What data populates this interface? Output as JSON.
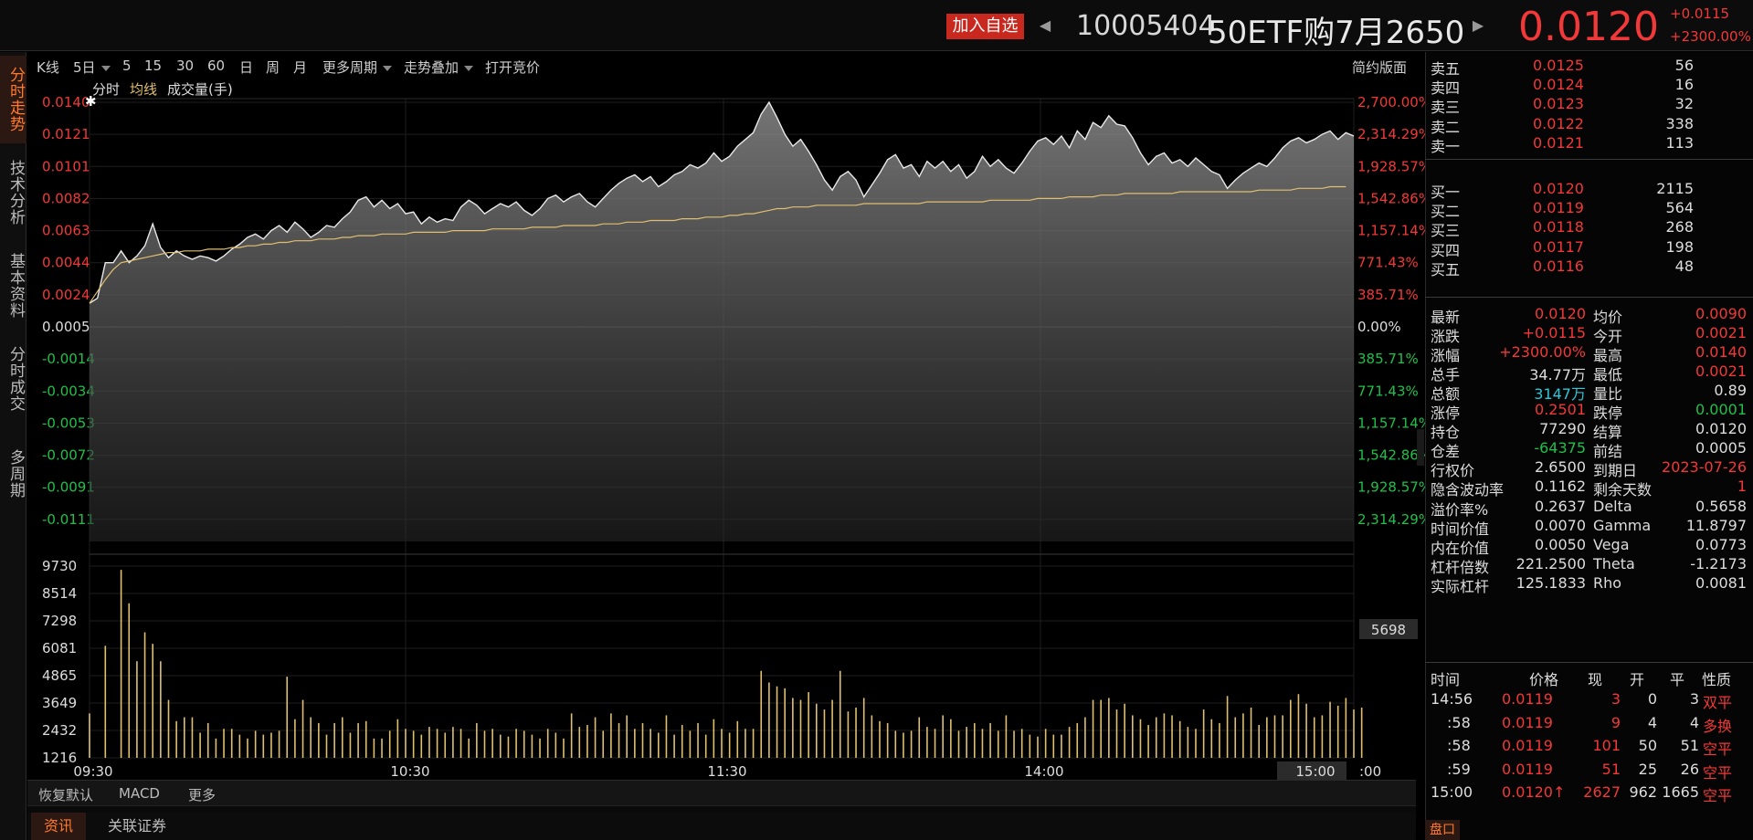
{
  "header": {
    "watch_label": "加入自选",
    "prev_icon": "◀",
    "next_icon": "▶",
    "code": "10005404",
    "name": "50ETF购7月2650",
    "price": "0.0120",
    "change": "+0.0115",
    "change_pct": "+2300.00%"
  },
  "left_tabs": [
    {
      "label": "分时走势",
      "active": true
    },
    {
      "label": "技术分析",
      "active": false
    },
    {
      "label": "基本资料",
      "active": false
    },
    {
      "label": "分时成交",
      "active": false
    },
    {
      "label": "多周期",
      "active": false
    }
  ],
  "toolbar": {
    "items": [
      "K线",
      "5日",
      "5",
      "15",
      "30",
      "60",
      "日",
      "周",
      "月"
    ],
    "more_periods": "更多周期",
    "overlay": "走势叠加",
    "auction": "打开竞价",
    "simple_layout": "简约版面"
  },
  "legend": {
    "timeshare": "分时",
    "avg": "均线",
    "volume": "成交量(手)"
  },
  "chart_data": {
    "type": "line",
    "price_axis_labels": [
      "0.0140",
      "0.0121",
      "0.0101",
      "0.0082",
      "0.0063",
      "0.0044",
      "0.0024",
      "0.0005",
      "-0.0014",
      "-0.0034",
      "-0.0053",
      "-0.0072",
      "-0.0091",
      "-0.0111"
    ],
    "pct_axis_labels": [
      "2,700.00%",
      "2,314.29%",
      "1,928.57%",
      "1,542.86%",
      "1,157.14%",
      "771.43%",
      "385.71%",
      "0.00%",
      "385.71%",
      "771.43%",
      "1,157.14%",
      "1,542.86%",
      "1,928.57%",
      "2,314.29%"
    ],
    "ylim": [
      -0.013,
      0.014
    ],
    "base_price": 0.0005,
    "volume_axis_labels": [
      "9730",
      "8514",
      "7298",
      "6081",
      "4865",
      "3649",
      "2432",
      "1216"
    ],
    "volume_max": 10400,
    "volume_cursor_label": "5698",
    "time_labels": [
      "09:30",
      "10:30",
      "11:30",
      "14:00",
      "15:00"
    ],
    "end_time_fragment": ":00",
    "price_series": [
      0.0021,
      0.0024,
      0.0045,
      0.0045,
      0.0052,
      0.0045,
      0.0049,
      0.0055,
      0.0068,
      0.0054,
      0.0048,
      0.0052,
      0.0049,
      0.0047,
      0.0049,
      0.0048,
      0.0046,
      0.0049,
      0.0053,
      0.0056,
      0.006,
      0.0062,
      0.0059,
      0.0064,
      0.0067,
      0.0063,
      0.0069,
      0.0065,
      0.006,
      0.0063,
      0.0067,
      0.0066,
      0.0071,
      0.0075,
      0.0082,
      0.0084,
      0.0078,
      0.0082,
      0.0077,
      0.008,
      0.0074,
      0.0075,
      0.0068,
      0.0072,
      0.0069,
      0.0071,
      0.007,
      0.0078,
      0.0082,
      0.0079,
      0.0074,
      0.0077,
      0.008,
      0.0078,
      0.0081,
      0.0076,
      0.0073,
      0.0077,
      0.0083,
      0.0085,
      0.0081,
      0.0084,
      0.0086,
      0.0081,
      0.0078,
      0.0083,
      0.0088,
      0.0092,
      0.0095,
      0.0097,
      0.0093,
      0.0096,
      0.009,
      0.0093,
      0.0097,
      0.0099,
      0.0103,
      0.0101,
      0.0104,
      0.011,
      0.0105,
      0.0108,
      0.0114,
      0.0118,
      0.0122,
      0.0133,
      0.014,
      0.0131,
      0.0121,
      0.0114,
      0.0118,
      0.0111,
      0.0103,
      0.0094,
      0.0088,
      0.0096,
      0.0099,
      0.0094,
      0.0084,
      0.0091,
      0.0098,
      0.0106,
      0.0109,
      0.0101,
      0.0103,
      0.0096,
      0.0105,
      0.0101,
      0.0105,
      0.0099,
      0.0103,
      0.0095,
      0.0099,
      0.0108,
      0.0102,
      0.0106,
      0.0101,
      0.0098,
      0.0104,
      0.0111,
      0.0117,
      0.0119,
      0.0115,
      0.012,
      0.0113,
      0.0123,
      0.0118,
      0.0128,
      0.0125,
      0.0132,
      0.0127,
      0.0126,
      0.0119,
      0.011,
      0.0103,
      0.0108,
      0.011,
      0.0104,
      0.0106,
      0.0102,
      0.0107,
      0.0103,
      0.0099,
      0.0097,
      0.0089,
      0.0094,
      0.0098,
      0.0101,
      0.0104,
      0.0102,
      0.0107,
      0.0113,
      0.0117,
      0.0119,
      0.0116,
      0.0118,
      0.0121,
      0.0123,
      0.0118,
      0.0122,
      0.012
    ],
    "avg_series": [
      0.0021,
      0.0028,
      0.0035,
      0.0041,
      0.0045,
      0.0046,
      0.0047,
      0.0048,
      0.0049,
      0.005,
      0.0051,
      0.0051,
      0.0052,
      0.0052,
      0.0052,
      0.0053,
      0.0053,
      0.0053,
      0.0054,
      0.0054,
      0.0055,
      0.0055,
      0.0056,
      0.0056,
      0.0057,
      0.0057,
      0.0058,
      0.0058,
      0.0058,
      0.0059,
      0.0059,
      0.0059,
      0.006,
      0.006,
      0.0061,
      0.0061,
      0.0061,
      0.0062,
      0.0062,
      0.0062,
      0.0062,
      0.0063,
      0.0063,
      0.0063,
      0.0063,
      0.0063,
      0.0064,
      0.0064,
      0.0064,
      0.0064,
      0.0064,
      0.0065,
      0.0065,
      0.0065,
      0.0065,
      0.0065,
      0.0066,
      0.0066,
      0.0066,
      0.0066,
      0.0067,
      0.0067,
      0.0067,
      0.0067,
      0.0067,
      0.0068,
      0.0068,
      0.0068,
      0.0069,
      0.0069,
      0.0069,
      0.007,
      0.007,
      0.007,
      0.007,
      0.0071,
      0.0071,
      0.0071,
      0.0072,
      0.0072,
      0.0072,
      0.0073,
      0.0073,
      0.0074,
      0.0074,
      0.0075,
      0.0076,
      0.0077,
      0.0077,
      0.0078,
      0.0078,
      0.0078,
      0.0079,
      0.0079,
      0.0079,
      0.0079,
      0.0079,
      0.0079,
      0.008,
      0.008,
      0.008,
      0.008,
      0.008,
      0.008,
      0.008,
      0.008,
      0.0081,
      0.0081,
      0.0081,
      0.0081,
      0.0081,
      0.0081,
      0.0081,
      0.0081,
      0.0082,
      0.0082,
      0.0082,
      0.0082,
      0.0082,
      0.0082,
      0.0083,
      0.0083,
      0.0083,
      0.0083,
      0.0084,
      0.0084,
      0.0084,
      0.0084,
      0.0085,
      0.0085,
      0.0085,
      0.0086,
      0.0086,
      0.0086,
      0.0086,
      0.0086,
      0.0086,
      0.0086,
      0.0087,
      0.0087,
      0.0087,
      0.0087,
      0.0087,
      0.0087,
      0.0087,
      0.0087,
      0.0087,
      0.0087,
      0.0088,
      0.0088,
      0.0088,
      0.0088,
      0.0088,
      0.0089,
      0.0089,
      0.0089,
      0.0089,
      0.009,
      0.009,
      0.009
    ],
    "volume_series": [
      2300,
      0,
      5800,
      0,
      9730,
      8000,
      5000,
      6500,
      5900,
      5000,
      3000,
      1900,
      2100,
      2100,
      1300,
      1800,
      1000,
      1500,
      1500,
      1200,
      1000,
      1400,
      1200,
      1300,
      1400,
      4200,
      2000,
      3000,
      2100,
      1800,
      1200,
      1800,
      2100,
      1300,
      1800,
      1900,
      1000,
      1000,
      1400,
      2000,
      1500,
      1400,
      1200,
      1600,
      1500,
      1300,
      1600,
      1500,
      1000,
      1800,
      1400,
      1500,
      1200,
      1100,
      1500,
      1400,
      1200,
      1000,
      1500,
      1300,
      1000,
      2300,
      1600,
      1700,
      2100,
      1400,
      2300,
      1800,
      2200,
      1500,
      1800,
      1500,
      1300,
      2200,
      1200,
      1700,
      1400,
      1800,
      1200,
      2000,
      1500,
      1300,
      1900,
      1500,
      1500,
      4500,
      3900,
      3700,
      3600,
      3100,
      3000,
      3400,
      2800,
      2500,
      3000,
      4500,
      2400,
      2600,
      3100,
      2200,
      1900,
      1800,
      1400,
      1300,
      1400,
      2100,
      1600,
      1500,
      2200,
      2000,
      1400,
      1600,
      1800,
      1500,
      1800,
      1400,
      2200,
      1400,
      1500,
      1200,
      1100,
      1500,
      1200,
      1200,
      1600,
      1800,
      2100,
      3000,
      3000,
      3100,
      2500,
      2800,
      2200,
      2000,
      1700,
      2100,
      2300,
      2200,
      1900,
      1600,
      1500,
      2500,
      2000,
      1800,
      3200,
      2100,
      2300,
      2600,
      1700,
      2100,
      2200,
      2200,
      3000,
      3300,
      2800,
      2100,
      2200,
      2900,
      2700,
      3100,
      2500,
      2600
    ]
  },
  "bottom_bar": {
    "restore": "恢复默认",
    "macd": "MACD",
    "more": "更多"
  },
  "footer": {
    "news": "资讯",
    "related": "关联证券"
  },
  "orderbook": {
    "sell": [
      {
        "label": "卖五",
        "price": "0.0125",
        "vol": "56"
      },
      {
        "label": "卖四",
        "price": "0.0124",
        "vol": "16"
      },
      {
        "label": "卖三",
        "price": "0.0123",
        "vol": "32"
      },
      {
        "label": "卖二",
        "price": "0.0122",
        "vol": "338"
      },
      {
        "label": "卖一",
        "price": "0.0121",
        "vol": "113"
      }
    ],
    "buy": [
      {
        "label": "买一",
        "price": "0.0120",
        "vol": "2115"
      },
      {
        "label": "买二",
        "price": "0.0119",
        "vol": "564"
      },
      {
        "label": "买三",
        "price": "0.0118",
        "vol": "268"
      },
      {
        "label": "买四",
        "price": "0.0117",
        "vol": "198"
      },
      {
        "label": "买五",
        "price": "0.0116",
        "vol": "48"
      }
    ]
  },
  "quote": [
    {
      "l1": "最新",
      "v1": "0.0120",
      "c1": "red",
      "l2": "均价",
      "v2": "0.0090",
      "c2": "red"
    },
    {
      "l1": "涨跌",
      "v1": "+0.0115",
      "c1": "red",
      "l2": "今开",
      "v2": "0.0021",
      "c2": "red"
    },
    {
      "l1": "涨幅",
      "v1": "+2300.00%",
      "c1": "red",
      "l2": "最高",
      "v2": "0.0140",
      "c2": "red"
    },
    {
      "l1": "总手",
      "v1": "34.77万",
      "c1": "white",
      "l2": "最低",
      "v2": "0.0021",
      "c2": "red"
    },
    {
      "l1": "总额",
      "v1": "3147万",
      "c1": "cyan",
      "l2": "量比",
      "v2": "0.89",
      "c2": "white"
    },
    {
      "l1": "涨停",
      "v1": "0.2501",
      "c1": "red",
      "l2": "跌停",
      "v2": "0.0001",
      "c2": "green"
    },
    {
      "l1": "持仓",
      "v1": "77290",
      "c1": "white",
      "l2": "结算",
      "v2": "0.0120",
      "c2": "white"
    },
    {
      "l1": "仓差",
      "v1": "-64375",
      "c1": "green",
      "l2": "前结",
      "v2": "0.0005",
      "c2": "white"
    },
    {
      "l1": "行权价",
      "v1": "2.6500",
      "c1": "white",
      "l2": "到期日",
      "v2": "2023-07-26",
      "c2": "red"
    },
    {
      "l1": "隐含波动率",
      "v1": "0.1162",
      "c1": "white",
      "l2": "剩余天数",
      "v2": "1",
      "c2": "red"
    },
    {
      "l1": "溢价率%",
      "v1": "0.2637",
      "c1": "white",
      "l2": "Delta",
      "v2": "0.5658",
      "c2": "white"
    },
    {
      "l1": "时间价值",
      "v1": "0.0070",
      "c1": "white",
      "l2": "Gamma",
      "v2": "11.8797",
      "c2": "white"
    },
    {
      "l1": "内在价值",
      "v1": "0.0050",
      "c1": "white",
      "l2": "Vega",
      "v2": "0.0773",
      "c2": "white"
    },
    {
      "l1": "杠杆倍数",
      "v1": "221.2500",
      "c1": "white",
      "l2": "Theta",
      "v2": "-1.2173",
      "c2": "white"
    },
    {
      "l1": "实际杠杆",
      "v1": "125.1833",
      "c1": "white",
      "l2": "Rho",
      "v2": "0.0081",
      "c2": "white"
    }
  ],
  "trades_header": [
    "时间",
    "价格",
    "现",
    "开",
    "平",
    "性质"
  ],
  "trades": [
    {
      "time": "14:56",
      "price": "0.0119",
      "cur": "3",
      "open": "0",
      "close": "3",
      "nature": "双平"
    },
    {
      "time": ":58",
      "price": "0.0119",
      "cur": "9",
      "open": "4",
      "close": "4",
      "nature": "多换"
    },
    {
      "time": ":58",
      "price": "0.0119",
      "cur": "101",
      "open": "50",
      "close": "51",
      "nature": "空平"
    },
    {
      "time": ":59",
      "price": "0.0119",
      "cur": "51",
      "open": "25",
      "close": "26",
      "nature": "空平"
    },
    {
      "time": "15:00",
      "price": "0.0120↑",
      "cur": "2627",
      "open": "962",
      "close": "1665",
      "nature": "空平"
    }
  ],
  "panel_button": "盘口",
  "colors": {
    "up": "#f23838",
    "down": "#1fc04a",
    "accent": "#ff7a2a",
    "avg_line": "#e0c070",
    "volume": "#e0c070"
  }
}
